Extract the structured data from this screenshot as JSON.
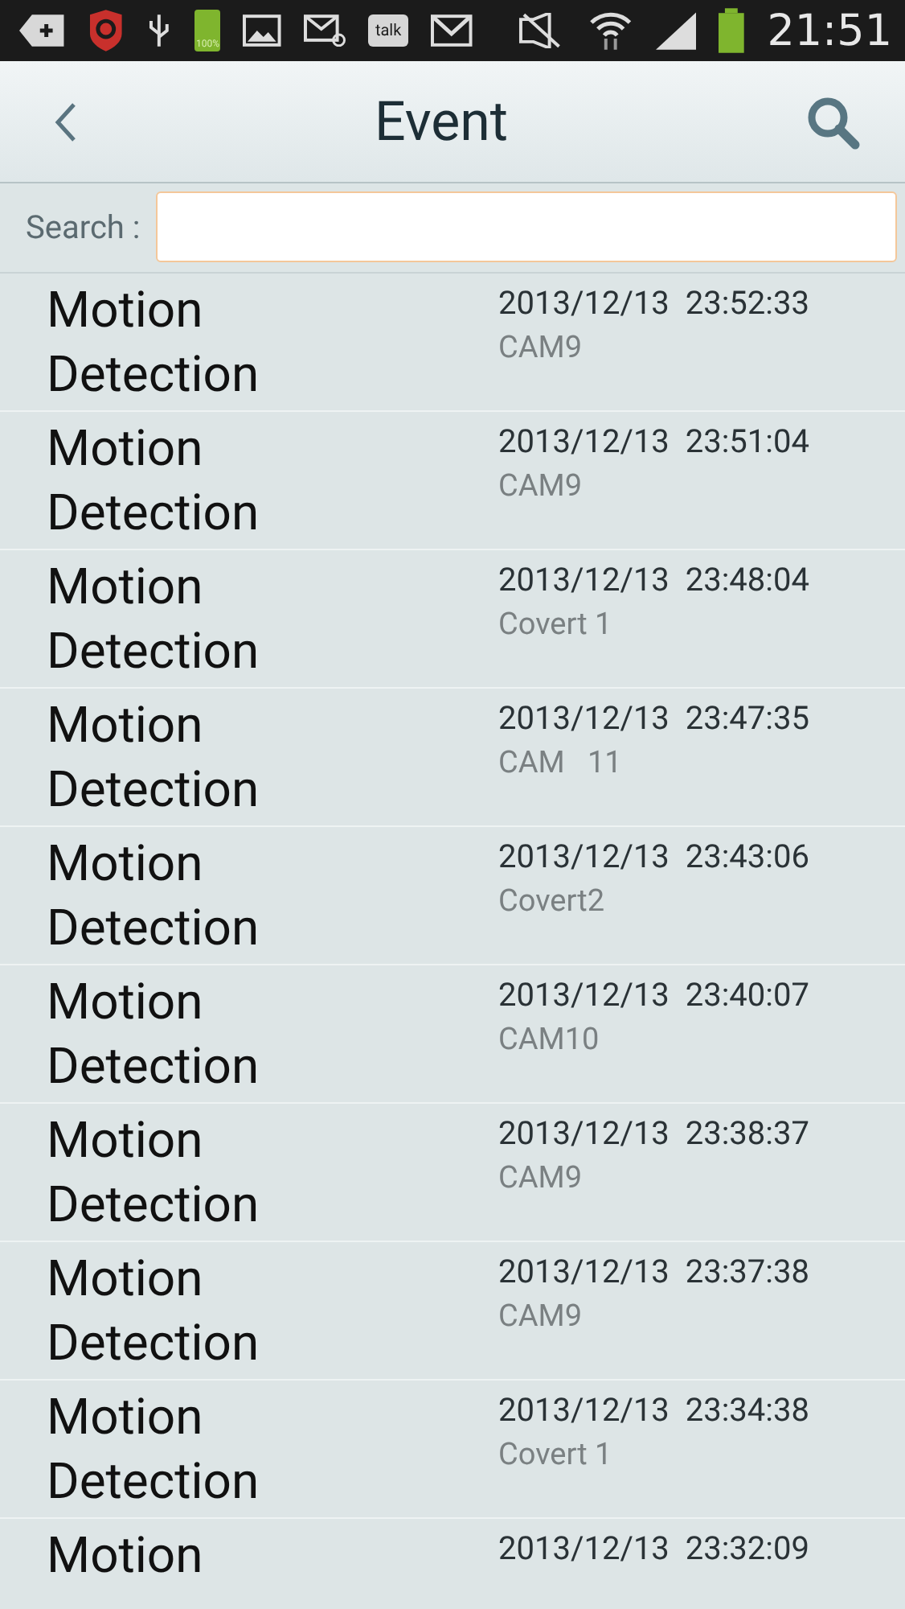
{
  "status_bar": {
    "battery_label": "100%",
    "talk_label": "talk",
    "time": "21:51"
  },
  "header": {
    "title": "Event"
  },
  "search": {
    "label": "Search :"
  },
  "events": [
    {
      "title": "Motion Detection",
      "datetime": "2013/12/13  23:52:33",
      "camera": "CAM9"
    },
    {
      "title": "Motion Detection",
      "datetime": "2013/12/13  23:51:04",
      "camera": "CAM9"
    },
    {
      "title": "Motion Detection",
      "datetime": "2013/12/13  23:48:04",
      "camera": "Covert 1"
    },
    {
      "title": "Motion Detection",
      "datetime": "2013/12/13  23:47:35",
      "camera": "CAM   11"
    },
    {
      "title": "Motion Detection",
      "datetime": "2013/12/13  23:43:06",
      "camera": "Covert2"
    },
    {
      "title": "Motion Detection",
      "datetime": "2013/12/13  23:40:07",
      "camera": "CAM10"
    },
    {
      "title": "Motion Detection",
      "datetime": "2013/12/13  23:38:37",
      "camera": "CAM9"
    },
    {
      "title": "Motion Detection",
      "datetime": "2013/12/13  23:37:38",
      "camera": "CAM9"
    },
    {
      "title": "Motion Detection",
      "datetime": "2013/12/13  23:34:38",
      "camera": "Covert 1"
    },
    {
      "title": "Motion",
      "datetime": "2013/12/13  23:32:09"
    }
  ]
}
